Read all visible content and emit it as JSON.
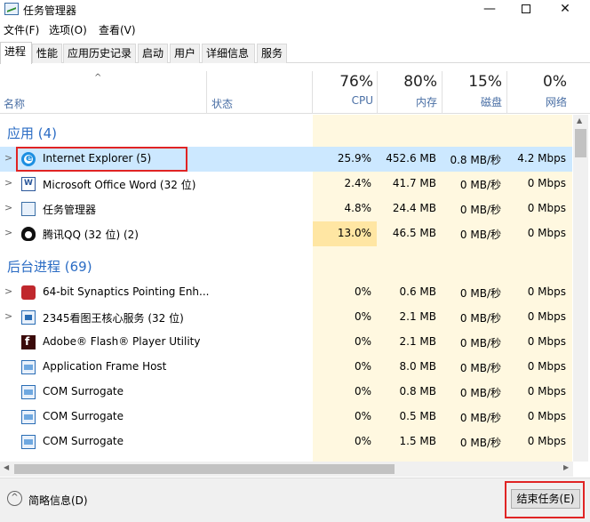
{
  "window": {
    "title": "任务管理器",
    "minimize": "—",
    "close": "✕"
  },
  "menu": [
    {
      "label": "文件(F)"
    },
    {
      "label": "选项(O)"
    },
    {
      "label": "查看(V)"
    }
  ],
  "tabs": [
    {
      "label": "进程",
      "active": true
    },
    {
      "label": "性能"
    },
    {
      "label": "应用历史记录"
    },
    {
      "label": "启动"
    },
    {
      "label": "用户"
    },
    {
      "label": "详细信息"
    },
    {
      "label": "服务"
    }
  ],
  "header": {
    "sort_arrow": "^",
    "name": "名称",
    "status": "状态",
    "cpu": {
      "pct": "76%",
      "label": "CPU"
    },
    "memory": {
      "pct": "80%",
      "label": "内存"
    },
    "disk": {
      "pct": "15%",
      "label": "磁盘"
    },
    "network": {
      "pct": "0%",
      "label": "网络"
    }
  },
  "groups": {
    "apps": "应用 (4)",
    "background": "后台进程 (69)"
  },
  "apps": [
    {
      "name": "Internet Explorer (5)",
      "icon": "ie-icon",
      "cpu": "25.9%",
      "mem": "452.6 MB",
      "disk": "0.8 MB/秒",
      "net": "4.2 Mbps"
    },
    {
      "name": "Microsoft Office Word (32 位)",
      "icon": "word-icon",
      "cpu": "2.4%",
      "mem": "41.7 MB",
      "disk": "0 MB/秒",
      "net": "0 Mbps"
    },
    {
      "name": "任务管理器",
      "icon": "task-manager-icon",
      "cpu": "4.8%",
      "mem": "24.4 MB",
      "disk": "0 MB/秒",
      "net": "0 Mbps"
    },
    {
      "name": "腾讯QQ (32 位) (2)",
      "icon": "qq-icon",
      "cpu": "13.0%",
      "mem": "46.5 MB",
      "disk": "0 MB/秒",
      "net": "0 Mbps"
    }
  ],
  "background": [
    {
      "name": "64-bit Synaptics Pointing Enh...",
      "icon": "synaptics-icon",
      "cpu": "0%",
      "mem": "0.6 MB",
      "disk": "0 MB/秒",
      "net": "0 Mbps"
    },
    {
      "name": "2345看图王核心服务 (32 位)",
      "icon": "2345-viewer-icon",
      "cpu": "0%",
      "mem": "2.1 MB",
      "disk": "0 MB/秒",
      "net": "0 Mbps"
    },
    {
      "name": "Adobe® Flash® Player Utility",
      "icon": "flash-icon",
      "cpu": "0%",
      "mem": "2.1 MB",
      "disk": "0 MB/秒",
      "net": "0 Mbps"
    },
    {
      "name": "Application Frame Host",
      "icon": "app-window-icon",
      "cpu": "0%",
      "mem": "8.0 MB",
      "disk": "0 MB/秒",
      "net": "0 Mbps"
    },
    {
      "name": "COM Surrogate",
      "icon": "app-window-icon",
      "cpu": "0%",
      "mem": "0.8 MB",
      "disk": "0 MB/秒",
      "net": "0 Mbps"
    },
    {
      "name": "COM Surrogate",
      "icon": "app-window-icon",
      "cpu": "0%",
      "mem": "0.5 MB",
      "disk": "0 MB/秒",
      "net": "0 Mbps"
    },
    {
      "name": "COM Surrogate",
      "icon": "app-window-icon",
      "cpu": "0%",
      "mem": "1.5 MB",
      "disk": "0 MB/秒",
      "net": "0 Mbps"
    }
  ],
  "footer": {
    "toggle": "^",
    "summary": "简略信息(D)",
    "end_task": "结束任务(E)"
  },
  "colors": {
    "accent": "#2b6cc4",
    "selected_row": "#cce8ff",
    "usage_bg": "#fff8e0",
    "highlight_box": "#e02424"
  }
}
